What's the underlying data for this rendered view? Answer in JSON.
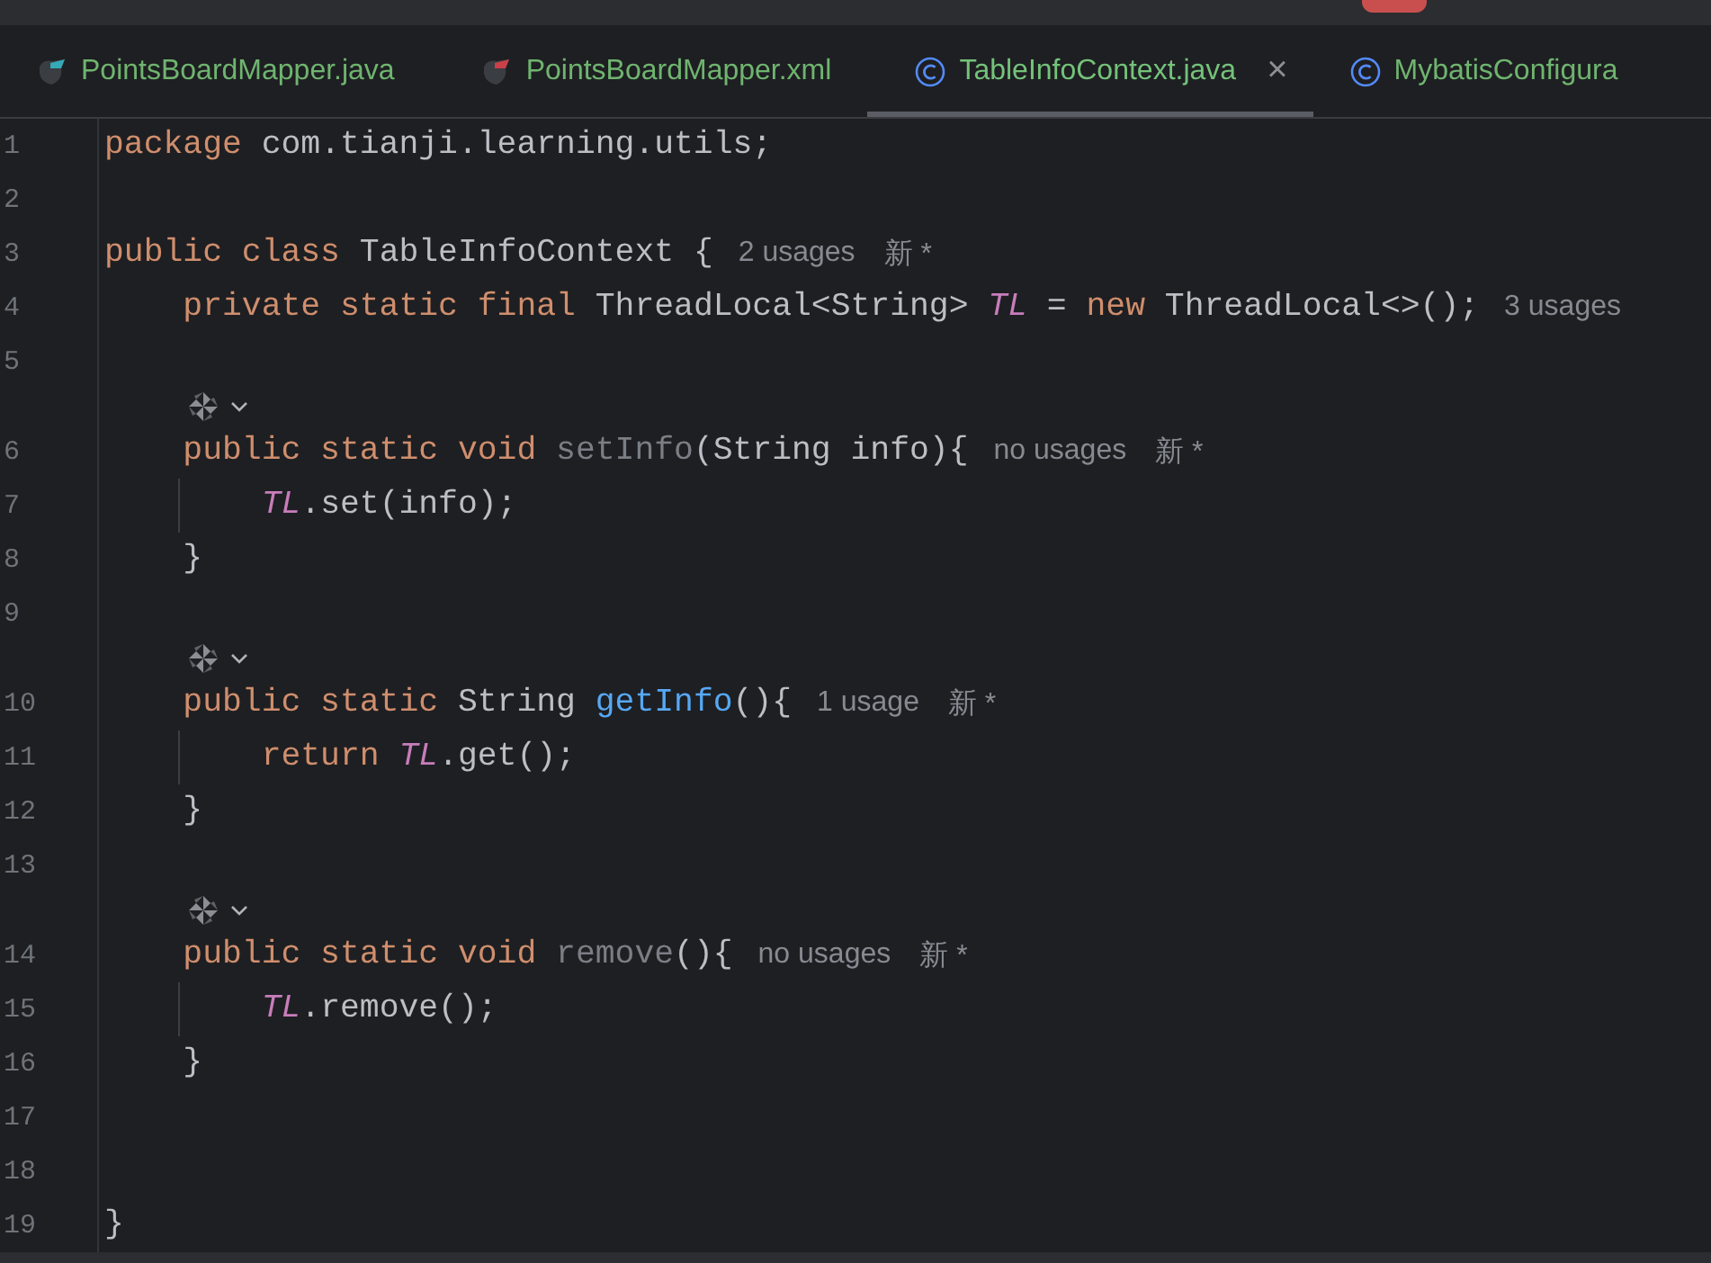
{
  "tabs": [
    {
      "kind": "mapper-java",
      "label": "PointsBoardMapper.java",
      "selected": false
    },
    {
      "kind": "mapper-xml",
      "label": "PointsBoardMapper.xml",
      "selected": false
    },
    {
      "kind": "class",
      "label": "TableInfoContext.java",
      "selected": true,
      "close": "×"
    },
    {
      "kind": "class",
      "label": "MybatisConfigura",
      "selected": false
    }
  ],
  "lines": [
    {
      "kind": "code",
      "number": "1",
      "tokens": [
        {
          "t": "package",
          "kind": "keyword"
        },
        {
          "t": " com.tianji.learning.utils;",
          "kind": "plain"
        }
      ]
    },
    {
      "kind": "code",
      "number": "2"
    },
    {
      "kind": "code",
      "number": "3",
      "tokens": [
        {
          "t": "public class",
          "kind": "keyword"
        },
        {
          "t": " TableInfoContext {",
          "kind": "plain"
        }
      ],
      "hints": [
        "2 usages",
        "新 *"
      ]
    },
    {
      "kind": "code",
      "number": "4",
      "tokens": [
        {
          "t": "    private static final",
          "kind": "keyword"
        },
        {
          "t": " ThreadLocal<String> ",
          "kind": "plain"
        },
        {
          "t": "TL",
          "kind": "field"
        },
        {
          "t": " = ",
          "kind": "plain"
        },
        {
          "t": "new",
          "kind": "keyword"
        },
        {
          "t": " ThreadLocal<>();",
          "kind": "plain"
        }
      ],
      "hints": [
        "3 usages"
      ]
    },
    {
      "kind": "code",
      "number": "5"
    },
    {
      "kind": "vision"
    },
    {
      "kind": "code",
      "number": "6",
      "tokens": [
        {
          "t": "    public static void ",
          "kind": "keyword"
        },
        {
          "t": "setInfo",
          "kind": "unused"
        },
        {
          "t": "(String info){",
          "kind": "plain"
        }
      ],
      "hints": [
        "no usages",
        "新 *"
      ]
    },
    {
      "kind": "code",
      "number": "7",
      "guide": true,
      "tokens": [
        {
          "t": "        TL",
          "kind": "field"
        },
        {
          "t": ".set(info);",
          "kind": "plain"
        }
      ]
    },
    {
      "kind": "code",
      "number": "8",
      "tokens": [
        {
          "t": "    }",
          "kind": "plain"
        }
      ]
    },
    {
      "kind": "code",
      "number": "9"
    },
    {
      "kind": "vision"
    },
    {
      "kind": "code",
      "number": "10",
      "tokens": [
        {
          "t": "    public static ",
          "kind": "keyword"
        },
        {
          "t": "String ",
          "kind": "plain"
        },
        {
          "t": "getInfo",
          "kind": "declaration"
        },
        {
          "t": "(){",
          "kind": "plain"
        }
      ],
      "hints": [
        "1 usage",
        "新 *"
      ]
    },
    {
      "kind": "code",
      "number": "11",
      "guide": true,
      "tokens": [
        {
          "t": "        return ",
          "kind": "keyword"
        },
        {
          "t": "TL",
          "kind": "field"
        },
        {
          "t": ".get();",
          "kind": "plain"
        }
      ]
    },
    {
      "kind": "code",
      "number": "12",
      "tokens": [
        {
          "t": "    }",
          "kind": "plain"
        }
      ]
    },
    {
      "kind": "code",
      "number": "13"
    },
    {
      "kind": "vision"
    },
    {
      "kind": "code",
      "number": "14",
      "tokens": [
        {
          "t": "    public static void ",
          "kind": "keyword"
        },
        {
          "t": "remove",
          "kind": "unused"
        },
        {
          "t": "(){",
          "kind": "plain"
        }
      ],
      "hints": [
        "no usages",
        "新 *"
      ]
    },
    {
      "kind": "code",
      "number": "15",
      "guide": true,
      "tokens": [
        {
          "t": "        TL",
          "kind": "field"
        },
        {
          "t": ".remove();",
          "kind": "plain"
        }
      ]
    },
    {
      "kind": "code",
      "number": "16",
      "tokens": [
        {
          "t": "    }",
          "kind": "plain"
        }
      ]
    },
    {
      "kind": "code",
      "number": "17"
    },
    {
      "kind": "code",
      "number": "18"
    },
    {
      "kind": "code",
      "number": "19",
      "tokens": [
        {
          "t": "}",
          "kind": "plain"
        }
      ]
    }
  ]
}
